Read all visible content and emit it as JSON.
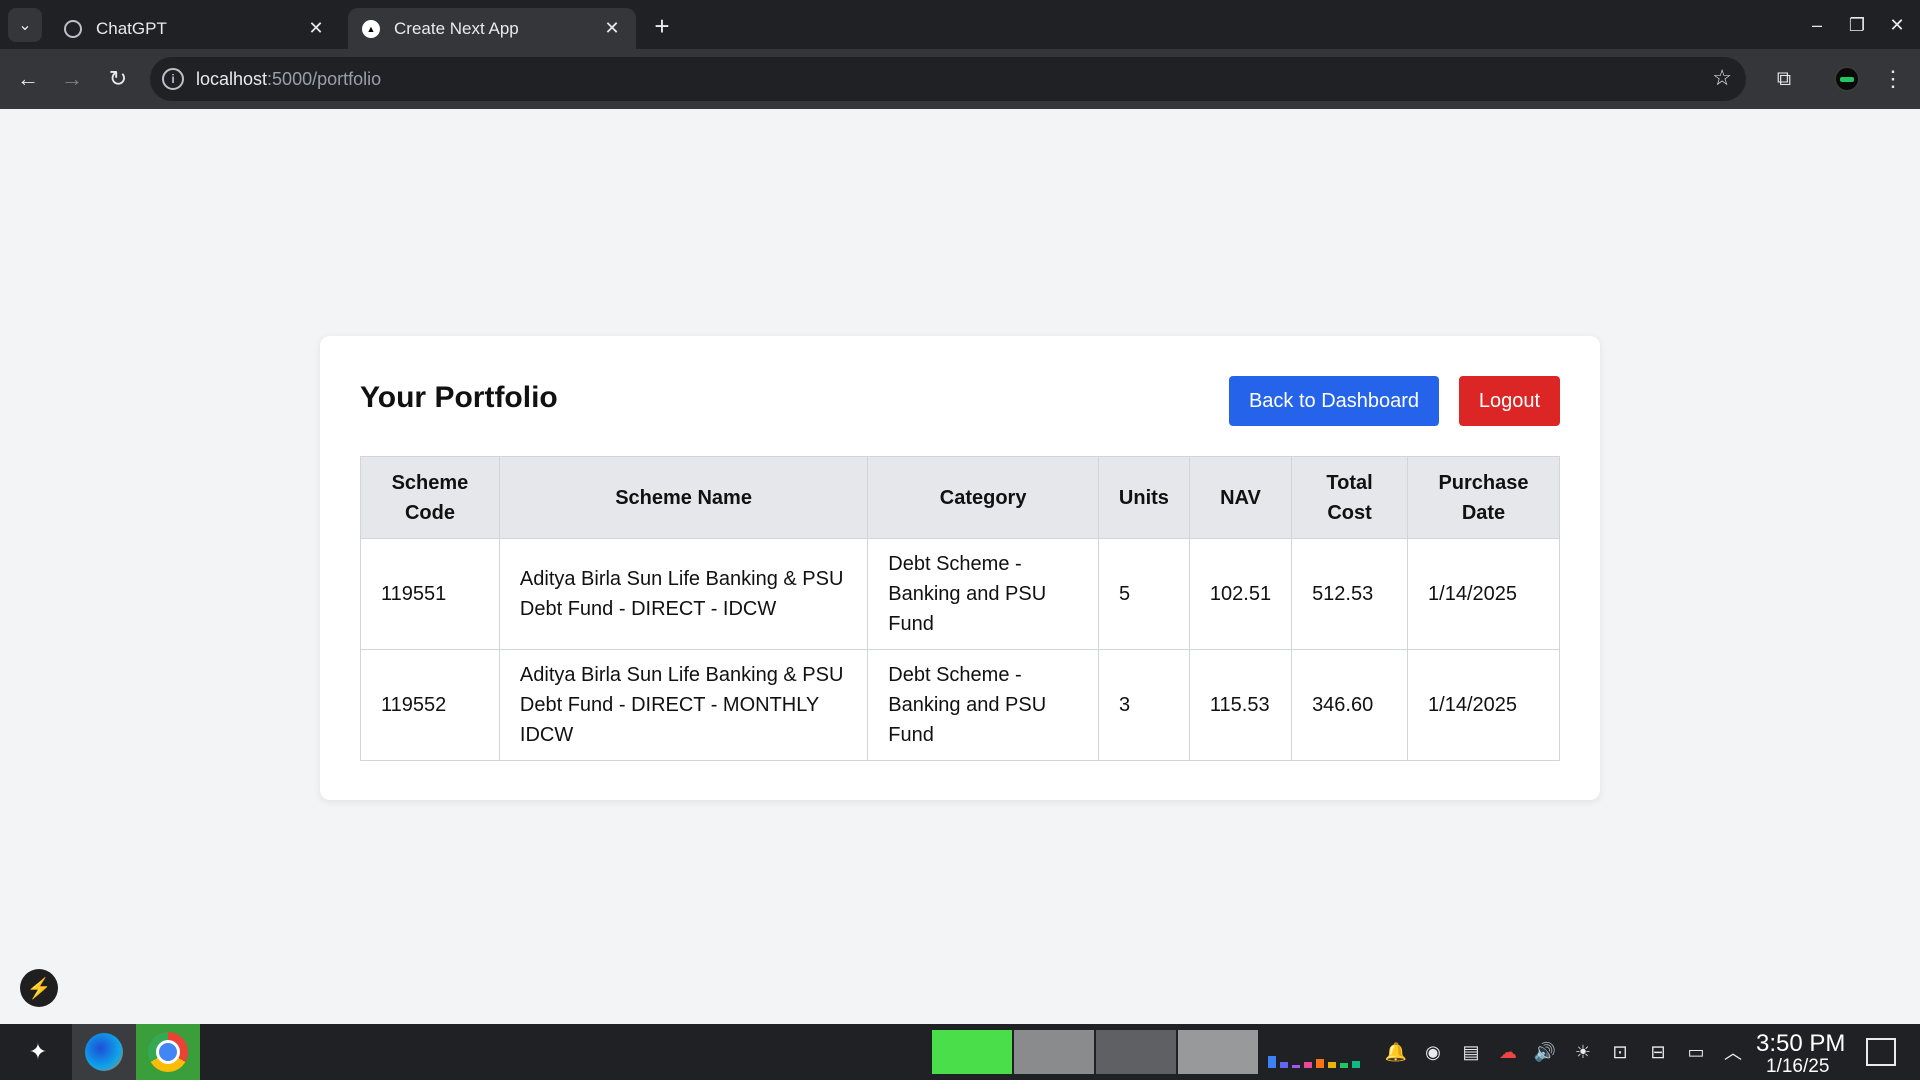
{
  "browser": {
    "tabs": [
      {
        "title": "ChatGPT",
        "favicon": "chatgpt-icon",
        "active": false
      },
      {
        "title": "Create Next App",
        "favicon": "nextjs-icon",
        "active": true
      }
    ],
    "url_host": "localhost",
    "url_path": ":5000/portfolio"
  },
  "page": {
    "title": "Your Portfolio",
    "back_label": "Back to Dashboard",
    "logout_label": "Logout",
    "colors": {
      "primary": "#2563eb",
      "danger": "#dc2626",
      "header_bg": "#e5e7eb",
      "page_bg": "#f3f4f6"
    }
  },
  "table": {
    "headers": [
      "Scheme\nCode",
      "Scheme Name",
      "Category",
      "Units",
      "NAV",
      "Total\nCost",
      "Purchase\nDate"
    ],
    "rows": [
      [
        "119551",
        "Aditya Birla Sun Life Banking & PSU Debt Fund - DIRECT - IDCW",
        "Debt Scheme - Banking and PSU Fund",
        "5",
        "102.51",
        "512.53",
        "1/14/2025"
      ],
      [
        "119552",
        "Aditya Birla Sun Life Banking & PSU Debt Fund - DIRECT - MONTHLY IDCW",
        "Debt Scheme - Banking and PSU Fund",
        "3",
        "115.53",
        "346.60",
        "1/14/2025"
      ]
    ]
  },
  "taskbar": {
    "time": "3:50 PM",
    "date": "1/16/25"
  }
}
